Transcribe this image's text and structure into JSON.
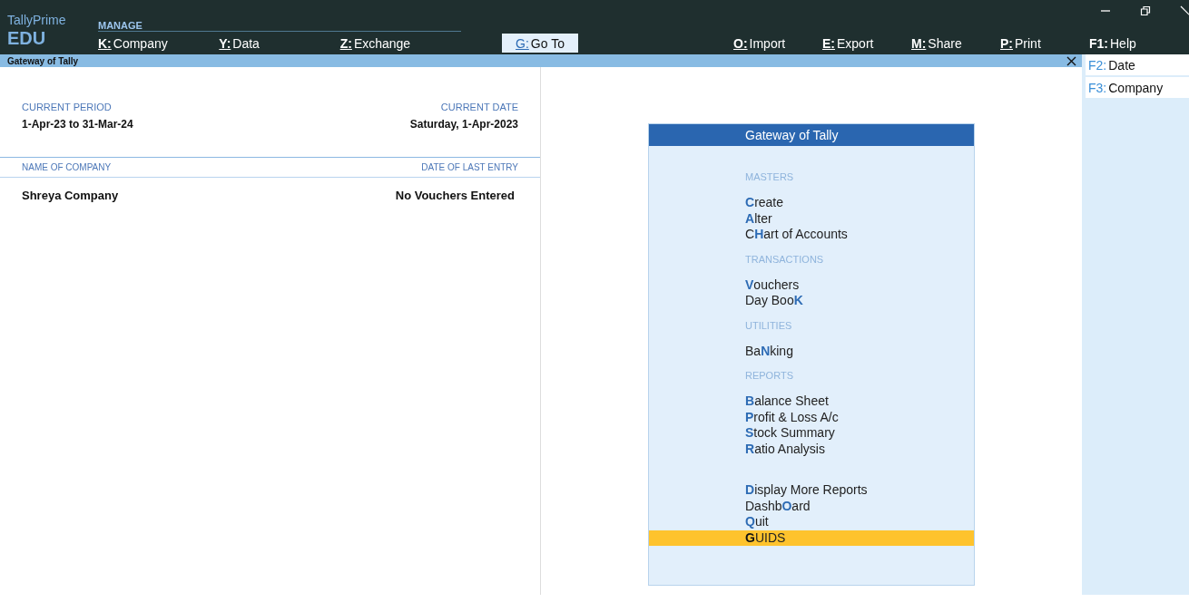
{
  "app": {
    "name": "TallyPrime",
    "edition": "EDU"
  },
  "menu_label": "MANAGE",
  "toolbar": {
    "left": [
      {
        "key": "K:",
        "label": "Company",
        "kind": "underlined"
      },
      {
        "key": "Y:",
        "label": "Data",
        "kind": "underlined"
      },
      {
        "key": "Z:",
        "label": "Exchange",
        "kind": "underlined"
      }
    ],
    "middle": [
      {
        "key": "G:",
        "label": "Go To",
        "kind": "boxed"
      }
    ],
    "right": [
      {
        "key": "O:",
        "label": "Import",
        "kind": "underlined"
      },
      {
        "key": "E:",
        "label": "Export",
        "kind": "underlined"
      },
      {
        "key": "M:",
        "label": "Share",
        "kind": "underlined"
      },
      {
        "key": "P:",
        "label": "Print",
        "kind": "underlined"
      },
      {
        "key": "F1:",
        "label": "Help",
        "kind": "plain"
      }
    ]
  },
  "window_title": "Gateway of Tally",
  "period": {
    "label": "CURRENT PERIOD",
    "value": "1-Apr-23 to 31-Mar-24"
  },
  "date": {
    "label": "CURRENT DATE",
    "value": "Saturday, 1-Apr-2023"
  },
  "company_table": {
    "columns": [
      "NAME OF COMPANY",
      "DATE OF LAST ENTRY"
    ],
    "rows": [
      [
        "Shreya Company",
        "No Vouchers Entered"
      ]
    ]
  },
  "gateway": {
    "title": "Gateway of Tally",
    "sections": [
      {
        "heading": "MASTERS",
        "items": [
          {
            "text": "**C**reate",
            "selected": false
          },
          {
            "text": "**A**lter",
            "selected": false
          },
          {
            "text": "C**H**art of Accounts",
            "selected": false
          }
        ]
      },
      {
        "heading": "TRANSACTIONS",
        "items": [
          {
            "text": "**V**ouchers",
            "selected": false
          },
          {
            "text": "Day Boo**K**",
            "selected": false
          }
        ]
      },
      {
        "heading": "UTILITIES",
        "items": [
          {
            "text": "Ba**N**king",
            "selected": false
          }
        ]
      },
      {
        "heading": "REPORTS",
        "items": [
          {
            "text": "**B**alance Sheet",
            "selected": false
          },
          {
            "text": "**P**rofit & Loss A/c",
            "selected": false
          },
          {
            "text": "**S**tock Summary",
            "selected": false
          },
          {
            "text": "**R**atio Analysis",
            "selected": false
          }
        ]
      },
      {
        "items": [
          {
            "text": "**D**isplay More Reports",
            "selected": false
          },
          {
            "text": "Dashb**O**ard",
            "selected": false
          },
          {
            "text": "**Q**uit",
            "selected": false
          },
          {
            "text": "**G**UIDS",
            "selected": true
          }
        ]
      }
    ]
  },
  "sidebar": [
    {
      "key": "F2:",
      "label": "Date"
    },
    {
      "key": "F3:",
      "label": "Company"
    }
  ]
}
